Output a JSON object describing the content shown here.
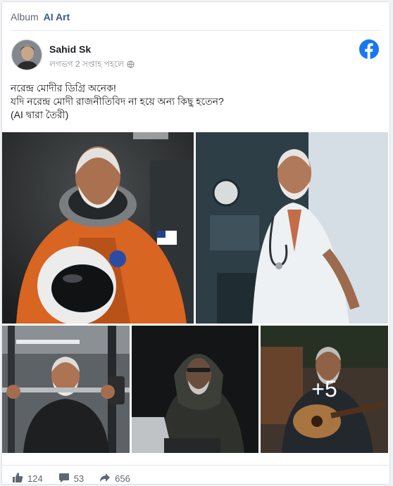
{
  "album": {
    "prefix": "Album",
    "name": "AI Art"
  },
  "post": {
    "author": "Sahid Sk",
    "time": "লগভগ 2 সপ্তাহ পহলে",
    "caption_lines": [
      "নরেন্দ্র মোদীর ডিগ্রি অনেক!",
      "যদি নরেন্দ্র মোদী রাজনীতিবিদ না হয়ে অন্য কিছু হতেন?",
      "(AI দ্বারা তৈরী)"
    ]
  },
  "photos": {
    "more_label": "+5",
    "items": [
      {
        "subject": "astronaut"
      },
      {
        "subject": "doctor"
      },
      {
        "subject": "gym"
      },
      {
        "subject": "hoodie-laptop"
      },
      {
        "subject": "guitar"
      }
    ]
  },
  "stats": {
    "likes": "124",
    "comments": "53",
    "shares": "656"
  },
  "colors": {
    "accent": "#385898",
    "facebook_blue": "#1877f2",
    "muted": "#606770"
  },
  "icons": [
    "globe-icon",
    "facebook-logo-icon",
    "like-icon",
    "comment-icon",
    "share-icon"
  ]
}
